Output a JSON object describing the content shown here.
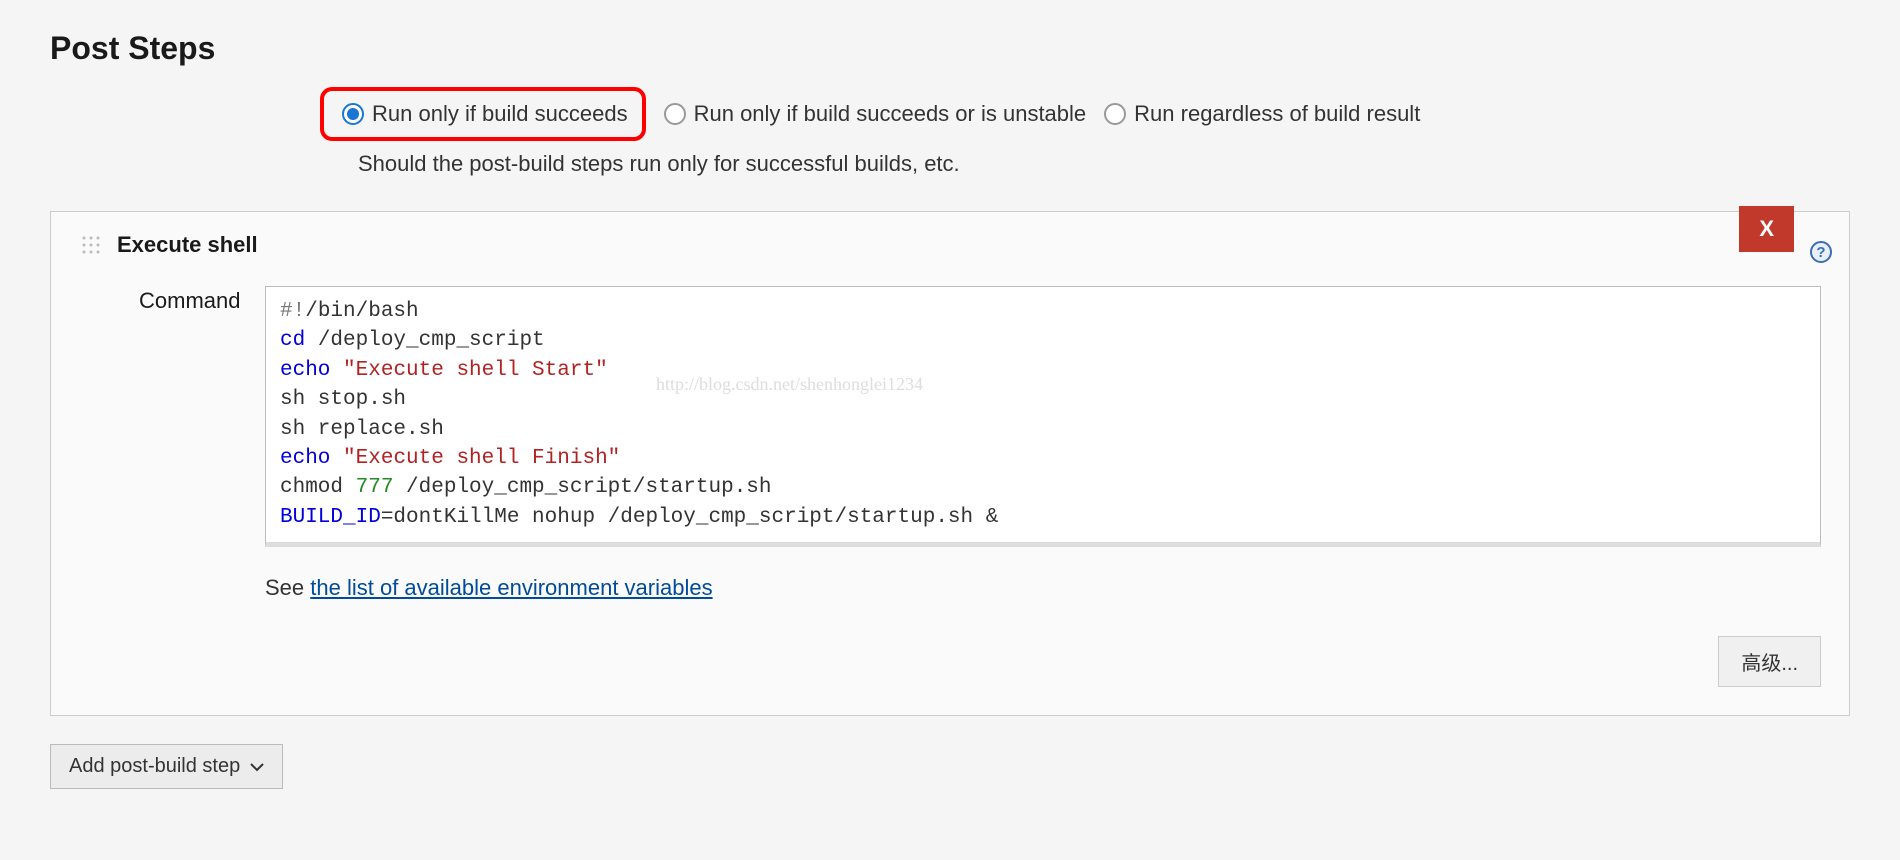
{
  "section": {
    "title": "Post Steps"
  },
  "radios": {
    "option1": "Run only if build succeeds",
    "option2": "Run only if build succeeds or is unstable",
    "option3": "Run regardless of build result",
    "description": "Should the post-build steps run only for successful builds, etc."
  },
  "step": {
    "title": "Execute shell",
    "delete_label": "X",
    "command_label": "Command",
    "see_prefix": "See ",
    "see_link": "the list of available environment variables",
    "advanced_label": "高级...",
    "watermark": "http://blog.csdn.net/shenhonglei1234",
    "cmd": {
      "l1a": "#!",
      "l1b": "/bin/bash",
      "l2a": "cd",
      "l2b": " /deploy_cmp_script",
      "l3a": "echo",
      "l3b": " ",
      "l3c": "\"Execute shell Start\"",
      "l4": "sh stop.sh",
      "l5": "sh replace.sh",
      "l6a": "echo",
      "l6b": " ",
      "l6c": "\"Execute shell Finish\"",
      "l7a": "chmod ",
      "l7b": "777",
      "l7c": " /deploy_cmp_script/startup.sh",
      "l8a": "BUILD_ID",
      "l8b": "=dontKillMe nohup /deploy_cmp_script/startup.sh &"
    }
  },
  "add_step_label": "Add post-build step"
}
